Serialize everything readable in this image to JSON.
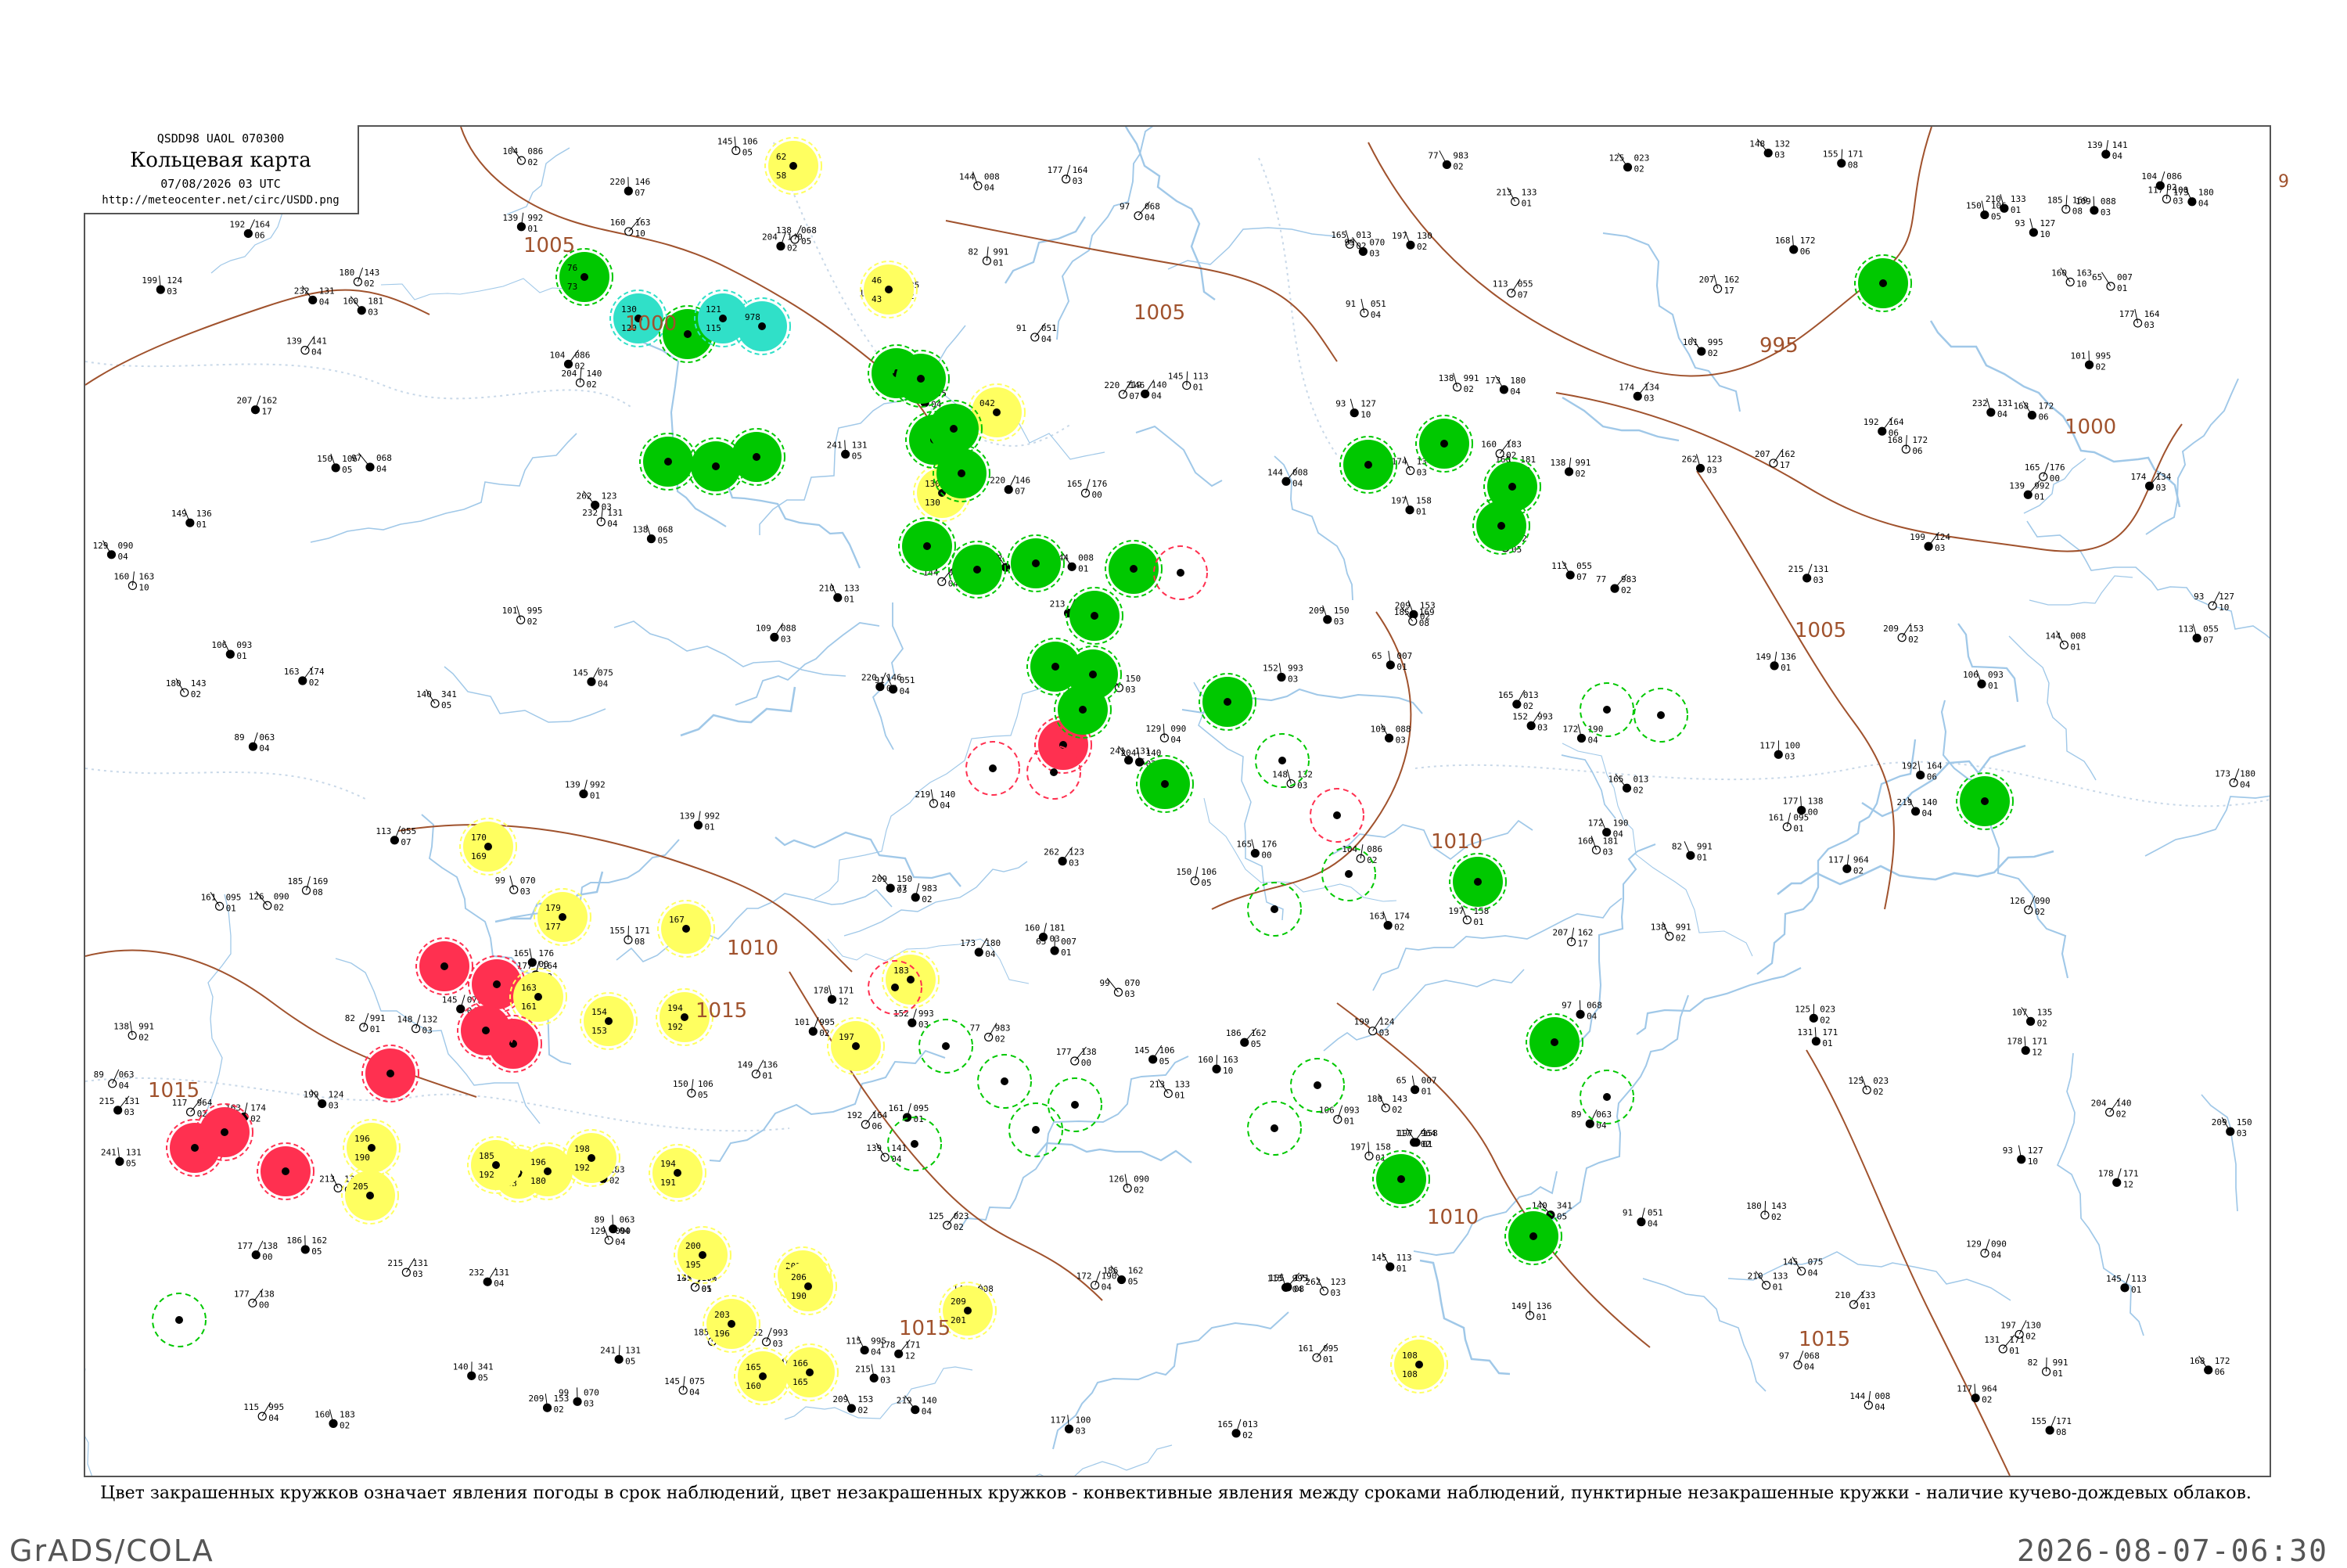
{
  "header": {
    "code_line": "QSDD98  UAOL  070300",
    "title": "Кольцевая карта",
    "datetime": "07/08/2026 03 UTC",
    "url": "http://meteocenter.net/circ/USDD.png"
  },
  "caption": "Цвет закрашенных кружков означает явления погоды в срок наблюдений, цвет незакрашенных кружков - конвективные явления между сроками наблюдений, пунктирные незакрашенные кружки - наличие кучево-дождевых облаков.",
  "footer": {
    "left": "GrADS/COLA",
    "right": "2026-08-07-06:30"
  },
  "edge_label": "9",
  "isobar_labels": [
    "1005",
    "1000",
    "1005",
    "995",
    "1000",
    "1005",
    "1010",
    "1010",
    "1015",
    "1015",
    "1015",
    "1015",
    "1010"
  ],
  "colors": {
    "rain": "#00c800",
    "drizzle_fog": "#30e0c8",
    "thunder": "#ff3050",
    "shower_haze": "#ffff60",
    "isobar": "#a0522d",
    "river": "#a0c8e8",
    "border": "#c8d8e8"
  },
  "legend_meaning": {
    "filled": "weather phenomena at observation time",
    "open": "convective phenomena between observations",
    "dashed": "cumulonimbus present"
  },
  "station_circles": [
    {
      "kind": "rain",
      "style": "filled",
      "a": "76",
      "b": "73"
    },
    {
      "kind": "drizzle_fog",
      "style": "filled",
      "a": "130",
      "b": "120"
    },
    {
      "kind": "rain",
      "style": "filled",
      "a": "",
      "b": ""
    },
    {
      "kind": "drizzle_fog",
      "style": "filled",
      "a": "121",
      "b": "115"
    },
    {
      "kind": "drizzle_fog",
      "style": "filled",
      "a": "978",
      "b": ""
    },
    {
      "kind": "shower_haze",
      "style": "filled",
      "a": "62",
      "b": "58"
    },
    {
      "kind": "shower_haze",
      "style": "filled",
      "a": "46",
      "b": "43"
    },
    {
      "kind": "rain",
      "style": "filled",
      "a": "",
      "b": ""
    },
    {
      "kind": "shower_haze",
      "style": "filled",
      "a": "042",
      "b": ""
    },
    {
      "kind": "rain",
      "style": "filled",
      "a": "",
      "b": ""
    },
    {
      "kind": "shower_haze",
      "style": "filled",
      "a": "130",
      "b": "130"
    },
    {
      "kind": "rain",
      "style": "filled",
      "a": "",
      "b": ""
    },
    {
      "kind": "rain",
      "style": "filled",
      "a": "",
      "b": ""
    },
    {
      "kind": "rain",
      "style": "filled",
      "a": "",
      "b": ""
    },
    {
      "kind": "rain",
      "style": "filled",
      "a": "",
      "b": ""
    },
    {
      "kind": "thunder",
      "style": "filled",
      "a": "",
      "b": ""
    },
    {
      "kind": "rain",
      "style": "filled",
      "a": "",
      "b": ""
    },
    {
      "kind": "rain",
      "style": "filled",
      "a": "",
      "b": ""
    },
    {
      "kind": "rain",
      "style": "filled",
      "a": "",
      "b": ""
    },
    {
      "kind": "rain",
      "style": "filled",
      "a": "",
      "b": ""
    },
    {
      "kind": "rain",
      "style": "filled",
      "a": "",
      "b": ""
    },
    {
      "kind": "shower_haze",
      "style": "filled",
      "a": "170",
      "b": "169"
    },
    {
      "kind": "shower_haze",
      "style": "filled",
      "a": "179",
      "b": "177"
    },
    {
      "kind": "shower_haze",
      "style": "filled",
      "a": "167",
      "b": ""
    },
    {
      "kind": "thunder",
      "style": "filled",
      "a": "",
      "b": ""
    },
    {
      "kind": "thunder",
      "style": "filled",
      "a": "",
      "b": ""
    },
    {
      "kind": "shower_haze",
      "style": "filled",
      "a": "163",
      "b": "161"
    },
    {
      "kind": "shower_haze",
      "style": "filled",
      "a": "154",
      "b": "153"
    },
    {
      "kind": "shower_haze",
      "style": "filled",
      "a": "194",
      "b": "192"
    },
    {
      "kind": "shower_haze",
      "style": "filled",
      "a": "183",
      "b": ""
    },
    {
      "kind": "shower_haze",
      "style": "filled",
      "a": "197",
      "b": ""
    },
    {
      "kind": "thunder",
      "style": "filled",
      "a": "",
      "b": ""
    },
    {
      "kind": "thunder",
      "style": "filled",
      "a": "",
      "b": ""
    },
    {
      "kind": "thunder",
      "style": "filled",
      "a": "",
      "b": ""
    },
    {
      "kind": "thunder",
      "style": "filled",
      "a": "",
      "b": ""
    },
    {
      "kind": "thunder",
      "style": "filled",
      "a": "",
      "b": ""
    },
    {
      "kind": "thunder",
      "style": "filled",
      "a": "",
      "b": ""
    },
    {
      "kind": "shower_haze",
      "style": "filled",
      "a": "196",
      "b": "190"
    },
    {
      "kind": "shower_haze",
      "style": "filled",
      "a": "164",
      "b": "153"
    },
    {
      "kind": "shower_haze",
      "style": "filled",
      "a": "185",
      "b": "192"
    },
    {
      "kind": "shower_haze",
      "style": "filled",
      "a": "196",
      "b": "180"
    },
    {
      "kind": "shower_haze",
      "style": "filled",
      "a": "205",
      "b": ""
    },
    {
      "kind": "shower_haze",
      "style": "filled",
      "a": "198",
      "b": "192"
    },
    {
      "kind": "shower_haze",
      "style": "filled",
      "a": "194",
      "b": "191"
    },
    {
      "kind": "shower_haze",
      "style": "filled",
      "a": "200",
      "b": "195"
    },
    {
      "kind": "shower_haze",
      "style": "filled",
      "a": "202",
      "b": "176"
    },
    {
      "kind": "shower_haze",
      "style": "filled",
      "a": "206",
      "b": "190"
    },
    {
      "kind": "shower_haze",
      "style": "filled",
      "a": "166",
      "b": "165"
    },
    {
      "kind": "shower_haze",
      "style": "filled",
      "a": "209",
      "b": "201"
    },
    {
      "kind": "shower_haze",
      "style": "filled",
      "a": "203",
      "b": "196"
    },
    {
      "kind": "shower_haze",
      "style": "filled",
      "a": "165",
      "b": "160"
    },
    {
      "kind": "shower_haze",
      "style": "filled",
      "a": "108",
      "b": "108"
    },
    {
      "kind": "rain",
      "style": "filled",
      "a": "",
      "b": ""
    },
    {
      "kind": "rain",
      "style": "filled",
      "a": "",
      "b": ""
    },
    {
      "kind": "rain",
      "style": "filled",
      "a": "",
      "b": ""
    },
    {
      "kind": "rain",
      "style": "filled",
      "a": "",
      "b": ""
    },
    {
      "kind": "rain",
      "style": "filled",
      "a": "",
      "b": ""
    },
    {
      "kind": "rain",
      "style": "filled",
      "a": "",
      "b": ""
    },
    {
      "kind": "rain",
      "style": "filled",
      "a": "",
      "b": ""
    },
    {
      "kind": "rain",
      "style": "filled",
      "a": "",
      "b": ""
    },
    {
      "kind": "rain",
      "style": "filled",
      "a": "",
      "b": ""
    },
    {
      "kind": "rain",
      "style": "filled",
      "a": "",
      "b": ""
    },
    {
      "kind": "rain",
      "style": "filled",
      "a": "",
      "b": ""
    },
    {
      "kind": "rain",
      "style": "filled",
      "a": "",
      "b": ""
    },
    {
      "kind": "rain",
      "style": "filled",
      "a": "",
      "b": ""
    },
    {
      "kind": "rain",
      "style": "filled",
      "a": "",
      "b": ""
    },
    {
      "kind": "rain",
      "style": "filled",
      "a": "",
      "b": ""
    },
    {
      "kind": "rain",
      "style": "filled",
      "a": "",
      "b": ""
    },
    {
      "kind": "rain",
      "style": "filled",
      "a": "",
      "b": ""
    },
    {
      "kind": "rain",
      "style": "open",
      "a": "",
      "b": ""
    },
    {
      "kind": "rain",
      "style": "open",
      "a": "",
      "b": ""
    },
    {
      "kind": "rain",
      "style": "open",
      "a": "",
      "b": ""
    },
    {
      "kind": "rain",
      "style": "open",
      "a": "",
      "b": ""
    },
    {
      "kind": "rain",
      "style": "open",
      "a": "",
      "b": ""
    },
    {
      "kind": "rain",
      "style": "open",
      "a": "",
      "b": ""
    },
    {
      "kind": "thunder",
      "style": "open",
      "a": "",
      "b": ""
    },
    {
      "kind": "thunder",
      "style": "open",
      "a": "",
      "b": ""
    },
    {
      "kind": "thunder",
      "style": "open",
      "a": "",
      "b": ""
    },
    {
      "kind": "thunder",
      "style": "open",
      "a": "",
      "b": ""
    },
    {
      "kind": "thunder",
      "style": "open",
      "a": "",
      "b": ""
    },
    {
      "kind": "rain",
      "style": "open",
      "a": "",
      "b": ""
    },
    {
      "kind": "rain",
      "style": "open",
      "a": "",
      "b": ""
    },
    {
      "kind": "rain",
      "style": "open",
      "a": "",
      "b": ""
    },
    {
      "kind": "rain",
      "style": "open",
      "a": "",
      "b": ""
    },
    {
      "kind": "rain",
      "style": "open",
      "a": "",
      "b": ""
    },
    {
      "kind": "rain",
      "style": "open",
      "a": "",
      "b": ""
    },
    {
      "kind": "rain",
      "style": "open",
      "a": "",
      "b": ""
    },
    {
      "kind": "rain",
      "style": "open",
      "a": "",
      "b": ""
    }
  ],
  "station_models": [
    {
      "t": "113",
      "p": "055",
      "v": "07"
    },
    {
      "t": "93",
      "p": "127",
      "v": "10"
    },
    {
      "t": "139",
      "p": "992",
      "v": "01"
    },
    {
      "t": "165",
      "p": "013",
      "v": "02"
    },
    {
      "t": "144",
      "p": "008",
      "v": "04"
    },
    {
      "t": "185",
      "p": "169",
      "v": "08"
    },
    {
      "t": "172",
      "p": "190",
      "v": "04"
    },
    {
      "t": "180",
      "p": "143",
      "v": "02"
    },
    {
      "t": "207",
      "p": "162",
      "v": "17"
    },
    {
      "t": "209",
      "p": "150",
      "v": "03"
    },
    {
      "t": "219",
      "p": "140",
      "v": "04"
    },
    {
      "t": "220",
      "p": "146",
      "v": "07"
    },
    {
      "t": "232",
      "p": "131",
      "v": "04"
    },
    {
      "t": "262",
      "p": "123",
      "v": "03"
    },
    {
      "t": "213",
      "p": "133",
      "v": "01"
    },
    {
      "t": "204",
      "p": "140",
      "v": "02"
    },
    {
      "t": "215",
      "p": "131",
      "v": "03"
    },
    {
      "t": "241",
      "p": "131",
      "v": "05"
    },
    {
      "t": "210",
      "p": "133",
      "v": "01"
    },
    {
      "t": "192",
      "p": "164",
      "v": "06"
    },
    {
      "t": "160",
      "p": "163",
      "v": "10"
    },
    {
      "t": "178",
      "p": "171",
      "v": "12"
    },
    {
      "t": "199",
      "p": "124",
      "v": "03"
    },
    {
      "t": "209",
      "p": "153",
      "v": "02"
    },
    {
      "t": "173",
      "p": "180",
      "v": "04"
    },
    {
      "t": "165",
      "p": "176",
      "v": "00"
    },
    {
      "t": "177",
      "p": "138",
      "v": "00"
    },
    {
      "t": "160",
      "p": "181",
      "v": "03"
    },
    {
      "t": "197",
      "p": "158",
      "v": "01"
    },
    {
      "t": "186",
      "p": "162",
      "v": "05"
    },
    {
      "t": "149",
      "p": "136",
      "v": "01"
    },
    {
      "t": "155",
      "p": "171",
      "v": "08"
    },
    {
      "t": "168",
      "p": "172",
      "v": "06"
    },
    {
      "t": "161",
      "p": "095",
      "v": "01"
    },
    {
      "t": "117",
      "p": "100",
      "v": "03"
    },
    {
      "t": "129",
      "p": "090",
      "v": "04"
    },
    {
      "t": "150",
      "p": "106",
      "v": "05"
    },
    {
      "t": "145",
      "p": "075",
      "v": "04"
    },
    {
      "t": "117",
      "p": "964",
      "v": "02"
    },
    {
      "t": "138",
      "p": "991",
      "v": "02"
    },
    {
      "t": "152",
      "p": "993",
      "v": "03"
    },
    {
      "t": "125",
      "p": "023",
      "v": "02"
    },
    {
      "t": "144",
      "p": "008",
      "v": "01"
    },
    {
      "t": "99",
      "p": "070",
      "v": "03"
    },
    {
      "t": "77",
      "p": "983",
      "v": "02"
    },
    {
      "t": "82",
      "p": "991",
      "v": "01"
    },
    {
      "t": "101",
      "p": "995",
      "v": "02"
    },
    {
      "t": "115",
      "p": "995",
      "v": "04"
    },
    {
      "t": "91",
      "p": "051",
      "v": "04"
    },
    {
      "t": "65",
      "p": "007",
      "v": "01"
    },
    {
      "t": "89",
      "p": "063",
      "v": "04"
    },
    {
      "t": "97",
      "p": "068",
      "v": "04"
    },
    {
      "t": "104",
      "p": "086",
      "v": "02"
    },
    {
      "t": "109",
      "p": "088",
      "v": "03"
    },
    {
      "t": "106",
      "p": "093",
      "v": "01"
    },
    {
      "t": "126",
      "p": "090",
      "v": "02"
    },
    {
      "t": "145",
      "p": "106",
      "v": "05"
    },
    {
      "t": "138",
      "p": "068",
      "v": "05"
    },
    {
      "t": "148",
      "p": "132",
      "v": "03"
    },
    {
      "t": "140",
      "p": "341",
      "v": "05"
    },
    {
      "t": "145",
      "p": "113",
      "v": "01"
    },
    {
      "t": "107",
      "p": "135",
      "v": "02"
    },
    {
      "t": "139",
      "p": "141",
      "v": "04"
    },
    {
      "t": "174",
      "p": "134",
      "v": "03"
    },
    {
      "t": "197",
      "p": "130",
      "v": "02"
    },
    {
      "t": "160",
      "p": "183",
      "v": "02"
    },
    {
      "t": "163",
      "p": "174",
      "v": "02"
    },
    {
      "t": "177",
      "p": "164",
      "v": "03"
    },
    {
      "t": "131",
      "p": "171",
      "v": "01"
    }
  ]
}
